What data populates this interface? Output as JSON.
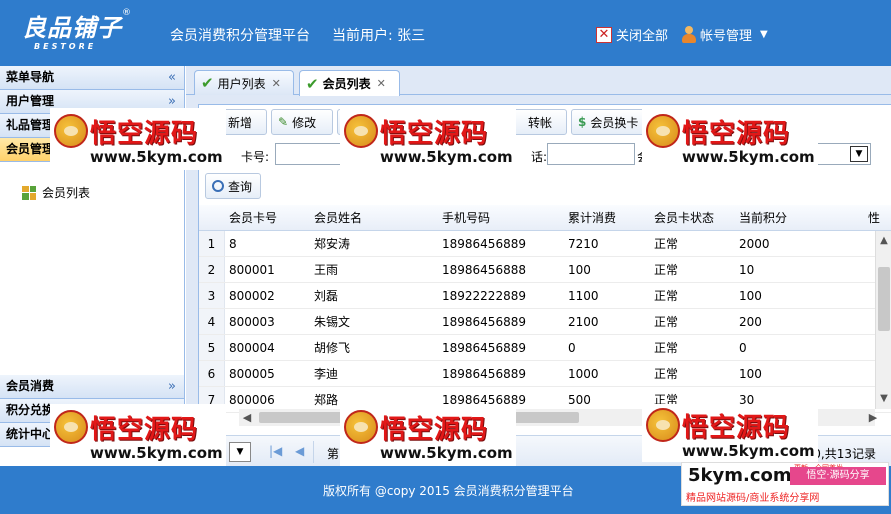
{
  "header": {
    "logo_cn": "良品铺子",
    "logo_reg": "®",
    "logo_en": "BESTORE",
    "title": "会员消费积分管理平台",
    "current_user": "当前用户: 张三",
    "close_all": "关闭全部",
    "account": "帐号管理"
  },
  "nav": {
    "menu_title": "菜单导航",
    "items": [
      "用户管理",
      "礼品管理",
      "会员管理",
      "会员消费",
      "积分兑换",
      "统计中心"
    ],
    "leaf": "会员列表"
  },
  "tabs": [
    {
      "label": "用户列表",
      "active": false
    },
    {
      "label": "会员列表",
      "active": true
    }
  ],
  "toolbar": {
    "add": "新增",
    "edit": "修改",
    "transfer": "转帐",
    "change_card": "会员换卡",
    "query": "查询"
  },
  "search": {
    "card_label": "卡号:",
    "phone_label": "话:",
    "sel_label": "会"
  },
  "grid": {
    "columns": [
      "会员卡号",
      "会员姓名",
      "手机号码",
      "累计消费",
      "会员卡状态",
      "当前积分",
      "性"
    ],
    "rows": [
      [
        "1",
        "8",
        "郑安涛",
        "18986456889",
        "7210",
        "正常",
        "2000"
      ],
      [
        "2",
        "800001",
        "王雨",
        "18986456888",
        "100",
        "正常",
        "10"
      ],
      [
        "3",
        "800002",
        "刘磊",
        "18922222889",
        "1100",
        "正常",
        "100"
      ],
      [
        "4",
        "800003",
        "朱锡文",
        "18986456889",
        "2100",
        "正常",
        "200"
      ],
      [
        "5",
        "800004",
        "胡修飞",
        "18986456889",
        "0",
        "正常",
        "0"
      ],
      [
        "6",
        "800005",
        "李迪",
        "18986456889",
        "1000",
        "正常",
        "100"
      ],
      [
        "7",
        "800006",
        "郑路",
        "18986456889",
        "500",
        "正常",
        "30"
      ]
    ]
  },
  "pager": {
    "page_prefix": "第",
    "total": "0,共13记录"
  },
  "footer": {
    "copyright": "版权所有 @copy 2015 会员消费积分管理平台"
  },
  "watermark": {
    "title": "悟空源码",
    "url": "www.5kym.com"
  },
  "brand_mark": {
    "tiny": "更新，全网首发",
    "big": "5kym.com",
    "tag": "悟空·源码分享",
    "sub": "精品网站源码/商业系统分享网"
  }
}
